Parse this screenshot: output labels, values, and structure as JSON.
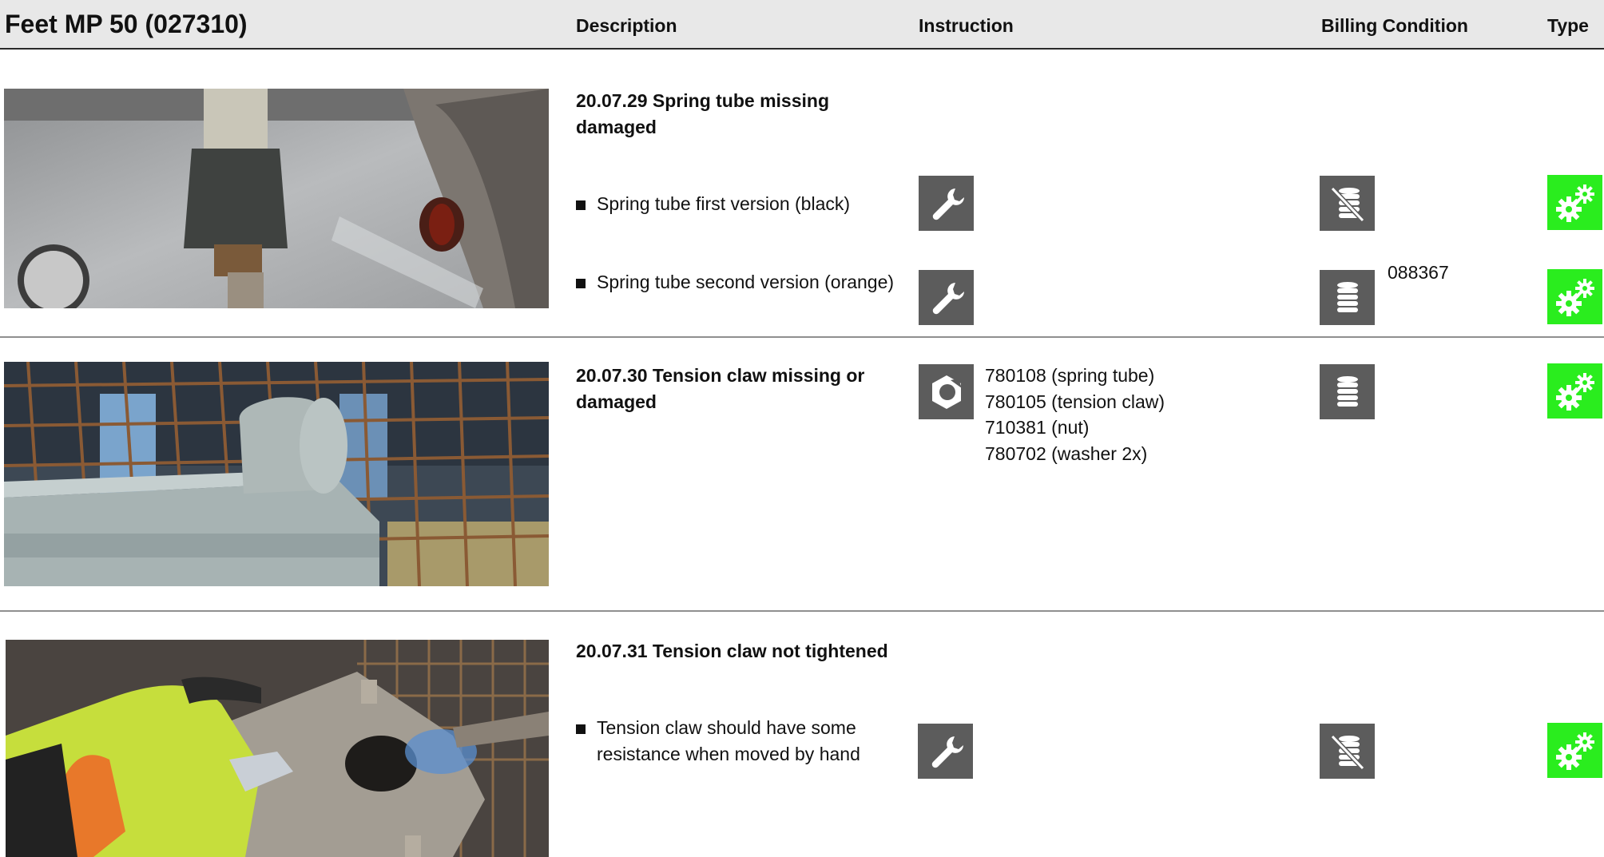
{
  "header": {
    "title": "Feet MP 50 (027310)",
    "columns": {
      "description": "Description",
      "instruction": "Instruction",
      "billing": "Billing Condition",
      "type": "Type"
    }
  },
  "entries": [
    {
      "heading": "20.07.29 Spring tube missing damaged",
      "items": [
        {
          "text": "Spring tube first version (black)",
          "instruction_icon": "wrench-icon",
          "billing_icon": "no-billing-coins-icon",
          "billing_code": "",
          "type_icon": "gears-icon"
        },
        {
          "text": "Spring tube second version (orange)",
          "instruction_icon": "wrench-icon",
          "billing_icon": "billing-coins-icon",
          "billing_code": "088367",
          "type_icon": "gears-icon"
        }
      ]
    },
    {
      "heading": "20.07.30 Tension claw missing or damaged",
      "instruction_icon": "nut-icon",
      "parts": [
        "780108 (spring tube)",
        "780105 (tension claw)",
        "710381 (nut)",
        "780702 (washer 2x)"
      ],
      "billing_icon": "billing-coins-icon",
      "type_icon": "gears-icon"
    },
    {
      "heading": "20.07.31 Tension claw not tightened",
      "items": [
        {
          "text": "Tension claw should have some resistance when moved by hand",
          "instruction_icon": "wrench-icon",
          "billing_icon": "no-billing-coins-icon",
          "billing_code": "",
          "type_icon": "gears-icon"
        }
      ]
    }
  ],
  "colors": {
    "icon_gray": "#5c5c5c",
    "type_green": "#2aed1e",
    "header_bg": "#e8e8e8"
  }
}
